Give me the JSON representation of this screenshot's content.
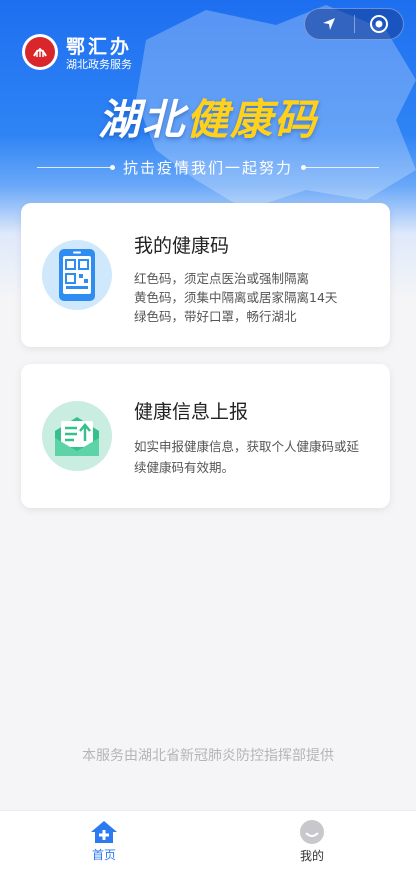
{
  "brand": {
    "name": "鄂汇办",
    "subtitle": "湖北政务服务"
  },
  "hero": {
    "title_part1": "湖北",
    "title_part2": "健康码",
    "slogan": "抗击疫情我们一起努力"
  },
  "capsule": {
    "left_icon": "location-arrow-icon",
    "right_icon": "close-target-icon"
  },
  "cards": [
    {
      "title": "我的健康码",
      "icon": "qr-code-phone-icon",
      "lines": [
        "红色码，须定点医治或强制隔离",
        "黄色码，须集中隔离或居家隔离14天",
        "绿色码，带好口罩，畅行湖北"
      ]
    },
    {
      "title": "健康信息上报",
      "icon": "report-envelope-icon",
      "desc": "如实申报健康信息，获取个人健康码或延续健康码有效期。"
    }
  ],
  "footer_note": "本服务由湖北省新冠肺炎防控指挥部提供",
  "tabbar": {
    "tabs": [
      {
        "label": "首页",
        "icon": "home-icon",
        "active": true
      },
      {
        "label": "我的",
        "icon": "user-face-icon",
        "active": false
      }
    ]
  },
  "colors": {
    "primary": "#2b7af0",
    "title_yellow": "#ffd11a"
  }
}
